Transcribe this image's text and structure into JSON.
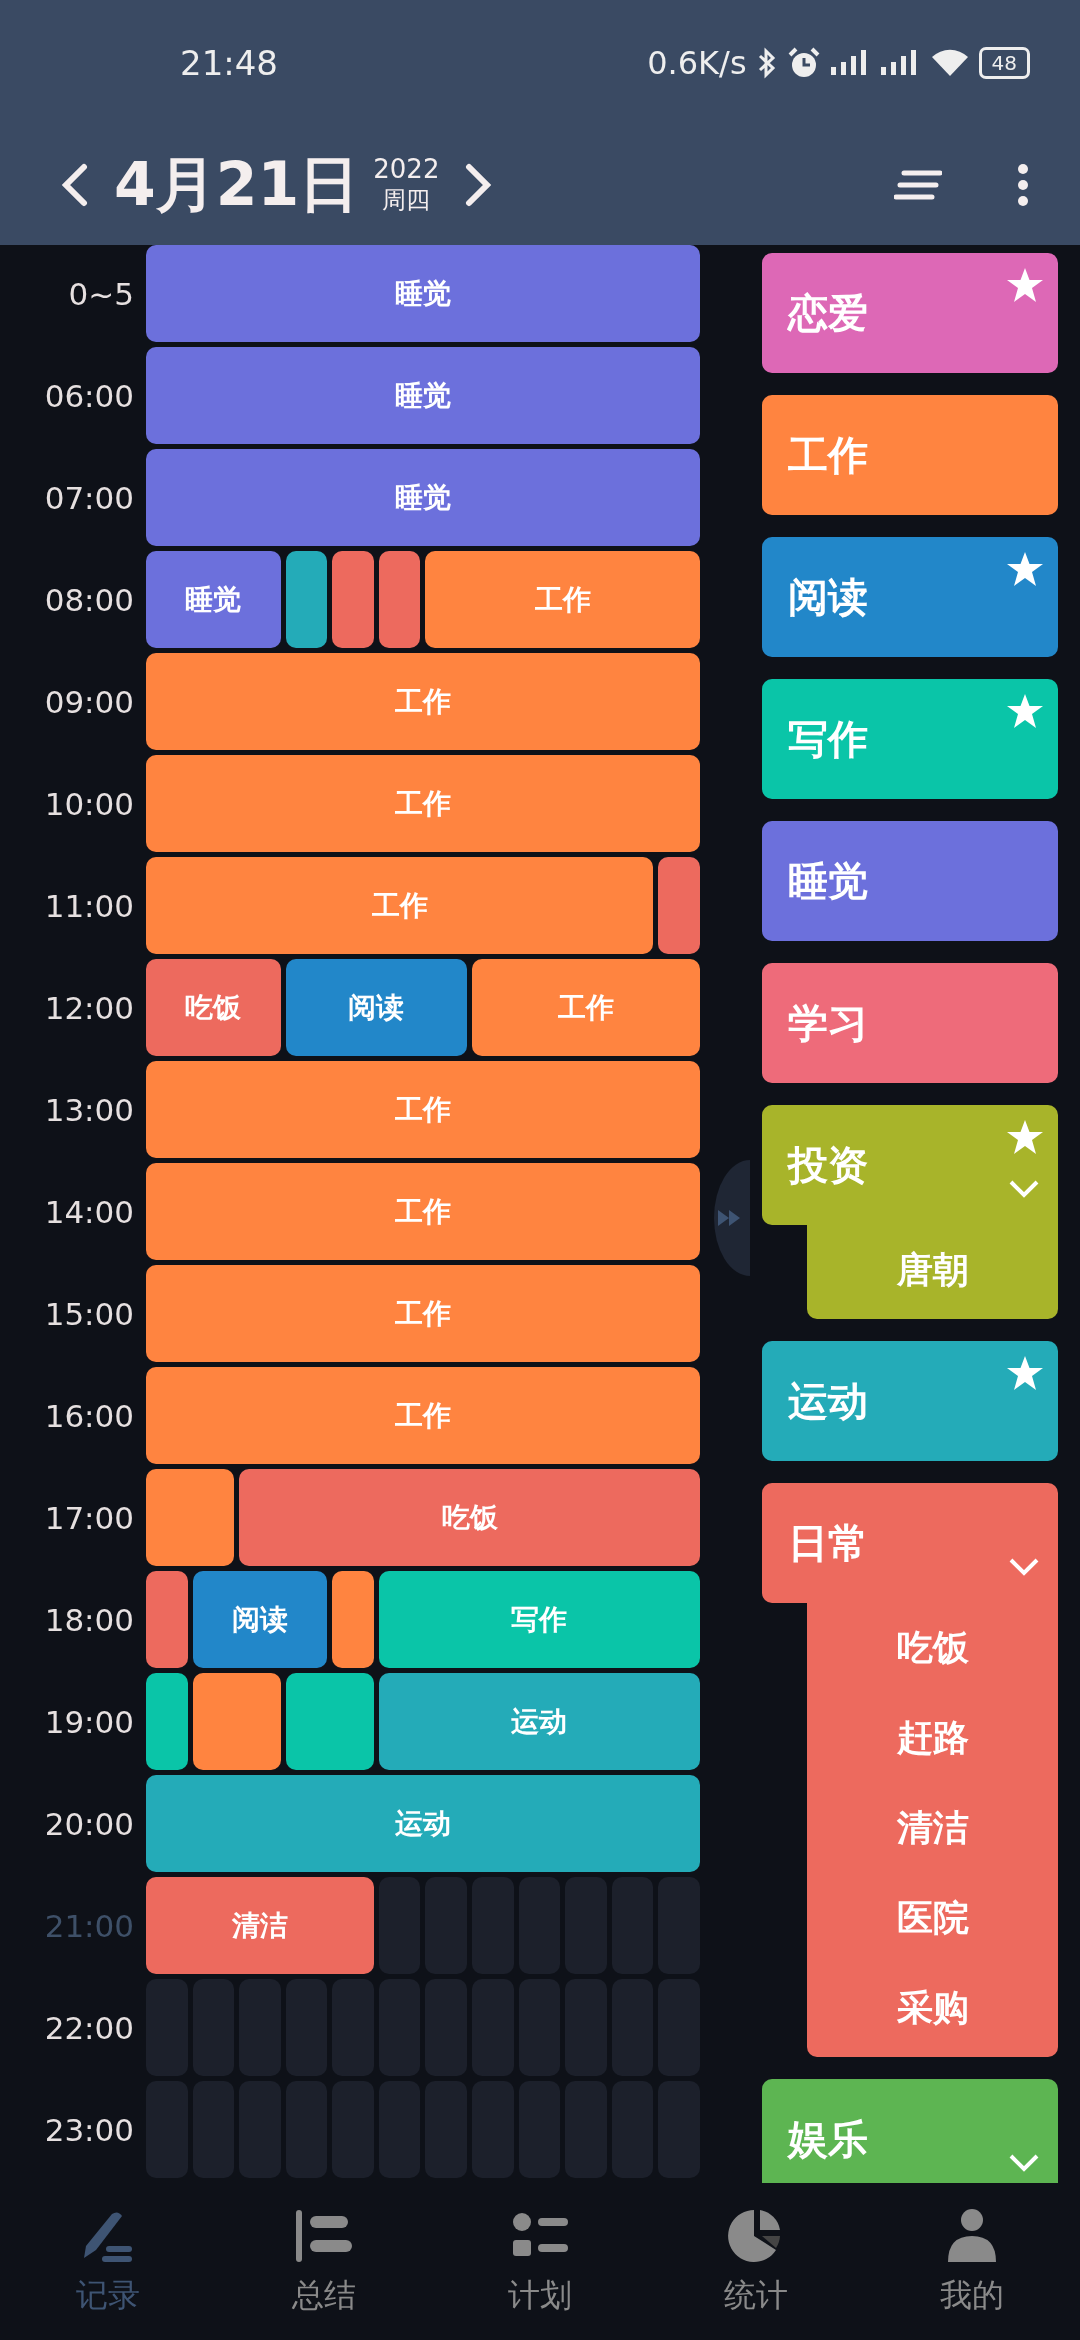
{
  "status_bar": {
    "time": "21:48",
    "speed": "0.6K/s",
    "battery": "48"
  },
  "header": {
    "date": "4月21日",
    "year": "2022",
    "weekday": "周四"
  },
  "timeline": [
    {
      "label": "0~5",
      "current": false,
      "cells": [
        {
          "kind": "activity",
          "color": "#6c70dc",
          "label": "睡觉",
          "joined": true
        },
        {
          "kind": "activity",
          "color": "#6c70dc",
          "joined": true
        },
        {
          "kind": "activity",
          "color": "#6c70dc",
          "joined": true
        },
        {
          "kind": "activity",
          "color": "#6c70dc",
          "joined": true
        },
        {
          "kind": "activity",
          "color": "#6c70dc",
          "joined": true
        },
        {
          "kind": "activity",
          "color": "#6c70dc",
          "joined": true
        },
        {
          "kind": "activity",
          "color": "#6c70dc",
          "joined": true
        },
        {
          "kind": "activity",
          "color": "#6c70dc",
          "joined": true
        },
        {
          "kind": "activity",
          "color": "#6c70dc",
          "joined": true
        },
        {
          "kind": "activity",
          "color": "#6c70dc",
          "joined": true
        },
        {
          "kind": "activity",
          "color": "#6c70dc",
          "joined": true
        },
        {
          "kind": "activity",
          "color": "#6c70dc",
          "joined": false
        }
      ]
    },
    {
      "label": "06:00",
      "current": false,
      "cells": [
        {
          "kind": "activity",
          "color": "#6c70dc",
          "label": "睡觉",
          "joined": true
        },
        {
          "kind": "activity",
          "color": "#6c70dc",
          "joined": true
        },
        {
          "kind": "activity",
          "color": "#6c70dc",
          "joined": true
        },
        {
          "kind": "activity",
          "color": "#6c70dc",
          "joined": true
        },
        {
          "kind": "activity",
          "color": "#6c70dc",
          "joined": true
        },
        {
          "kind": "activity",
          "color": "#6c70dc",
          "joined": true
        },
        {
          "kind": "activity",
          "color": "#6c70dc",
          "joined": true
        },
        {
          "kind": "activity",
          "color": "#6c70dc",
          "joined": true
        },
        {
          "kind": "activity",
          "color": "#6c70dc",
          "joined": true
        },
        {
          "kind": "activity",
          "color": "#6c70dc",
          "joined": true
        },
        {
          "kind": "activity",
          "color": "#6c70dc",
          "joined": true
        },
        {
          "kind": "activity",
          "color": "#6c70dc",
          "joined": false
        }
      ]
    },
    {
      "label": "07:00",
      "current": false,
      "cells": [
        {
          "kind": "activity",
          "color": "#6c70dc",
          "label": "睡觉",
          "joined": true
        },
        {
          "kind": "activity",
          "color": "#6c70dc",
          "joined": true
        },
        {
          "kind": "activity",
          "color": "#6c70dc",
          "joined": true
        },
        {
          "kind": "activity",
          "color": "#6c70dc",
          "joined": true
        },
        {
          "kind": "activity",
          "color": "#6c70dc",
          "joined": true
        },
        {
          "kind": "activity",
          "color": "#6c70dc",
          "joined": true
        },
        {
          "kind": "activity",
          "color": "#6c70dc",
          "joined": true
        },
        {
          "kind": "activity",
          "color": "#6c70dc",
          "joined": true
        },
        {
          "kind": "activity",
          "color": "#6c70dc",
          "joined": true
        },
        {
          "kind": "activity",
          "color": "#6c70dc",
          "joined": true
        },
        {
          "kind": "activity",
          "color": "#6c70dc",
          "joined": true
        },
        {
          "kind": "activity",
          "color": "#6c70dc",
          "joined": false
        }
      ]
    },
    {
      "label": "08:00",
      "current": false,
      "cells": [
        {
          "kind": "activity",
          "color": "#6c70dc",
          "label": "睡觉",
          "joined": true
        },
        {
          "kind": "activity",
          "color": "#6c70dc",
          "joined": true
        },
        {
          "kind": "activity",
          "color": "#6c70dc",
          "joined": false
        },
        {
          "kind": "activity",
          "color": "#24abb8",
          "joined": false
        },
        {
          "kind": "activity",
          "color": "#ed6a5e",
          "joined": false
        },
        {
          "kind": "activity",
          "color": "#ed6a5e",
          "joined": false
        },
        {
          "kind": "activity",
          "color": "#ff8440",
          "label": "工作",
          "joined": true
        },
        {
          "kind": "activity",
          "color": "#ff8440",
          "joined": true
        },
        {
          "kind": "activity",
          "color": "#ff8440",
          "joined": true
        },
        {
          "kind": "activity",
          "color": "#ff8440",
          "joined": true
        },
        {
          "kind": "activity",
          "color": "#ff8440",
          "joined": true
        },
        {
          "kind": "activity",
          "color": "#ff8440",
          "joined": false
        }
      ]
    },
    {
      "label": "09:00",
      "current": false,
      "cells": [
        {
          "kind": "activity",
          "color": "#ff8440",
          "label": "工作",
          "joined": true
        },
        {
          "kind": "activity",
          "color": "#ff8440",
          "joined": true
        },
        {
          "kind": "activity",
          "color": "#ff8440",
          "joined": true
        },
        {
          "kind": "activity",
          "color": "#ff8440",
          "joined": true
        },
        {
          "kind": "activity",
          "color": "#ff8440",
          "joined": true
        },
        {
          "kind": "activity",
          "color": "#ff8440",
          "joined": true
        },
        {
          "kind": "activity",
          "color": "#ff8440",
          "joined": true
        },
        {
          "kind": "activity",
          "color": "#ff8440",
          "joined": true
        },
        {
          "kind": "activity",
          "color": "#ff8440",
          "joined": true
        },
        {
          "kind": "activity",
          "color": "#ff8440",
          "joined": true
        },
        {
          "kind": "activity",
          "color": "#ff8440",
          "joined": true
        },
        {
          "kind": "activity",
          "color": "#ff8440",
          "joined": false
        }
      ]
    },
    {
      "label": "10:00",
      "current": false,
      "cells": [
        {
          "kind": "activity",
          "color": "#ff8440",
          "label": "工作",
          "joined": true
        },
        {
          "kind": "activity",
          "color": "#ff8440",
          "joined": true
        },
        {
          "kind": "activity",
          "color": "#ff8440",
          "joined": true
        },
        {
          "kind": "activity",
          "color": "#ff8440",
          "joined": true
        },
        {
          "kind": "activity",
          "color": "#ff8440",
          "joined": true
        },
        {
          "kind": "activity",
          "color": "#ff8440",
          "joined": true
        },
        {
          "kind": "activity",
          "color": "#ff8440",
          "joined": true
        },
        {
          "kind": "activity",
          "color": "#ff8440",
          "joined": true
        },
        {
          "kind": "activity",
          "color": "#ff8440",
          "joined": true
        },
        {
          "kind": "activity",
          "color": "#ff8440",
          "joined": true
        },
        {
          "kind": "activity",
          "color": "#ff8440",
          "joined": true
        },
        {
          "kind": "activity",
          "color": "#ff8440",
          "joined": false
        }
      ]
    },
    {
      "label": "11:00",
      "current": false,
      "cells": [
        {
          "kind": "activity",
          "color": "#ff8440",
          "label": "工作",
          "joined": true
        },
        {
          "kind": "activity",
          "color": "#ff8440",
          "joined": true
        },
        {
          "kind": "activity",
          "color": "#ff8440",
          "joined": true
        },
        {
          "kind": "activity",
          "color": "#ff8440",
          "joined": true
        },
        {
          "kind": "activity",
          "color": "#ff8440",
          "joined": true
        },
        {
          "kind": "activity",
          "color": "#ff8440",
          "joined": true
        },
        {
          "kind": "activity",
          "color": "#ff8440",
          "joined": true
        },
        {
          "kind": "activity",
          "color": "#ff8440",
          "joined": true
        },
        {
          "kind": "activity",
          "color": "#ff8440",
          "joined": true
        },
        {
          "kind": "activity",
          "color": "#ff8440",
          "joined": true
        },
        {
          "kind": "activity",
          "color": "#ff8440",
          "joined": false
        },
        {
          "kind": "activity",
          "color": "#ed6a5e",
          "joined": false
        }
      ]
    },
    {
      "label": "12:00",
      "current": false,
      "cells": [
        {
          "kind": "activity",
          "color": "#ed6a5e",
          "label": "吃饭",
          "joined": true
        },
        {
          "kind": "activity",
          "color": "#ed6a5e",
          "joined": true
        },
        {
          "kind": "activity",
          "color": "#ed6a5e",
          "joined": false
        },
        {
          "kind": "activity",
          "color": "#2287c9",
          "label": "阅读",
          "joined": true
        },
        {
          "kind": "activity",
          "color": "#2287c9",
          "joined": true
        },
        {
          "kind": "activity",
          "color": "#2287c9",
          "joined": true
        },
        {
          "kind": "activity",
          "color": "#2287c9",
          "joined": false
        },
        {
          "kind": "activity",
          "color": "#ff8440",
          "label": "工作",
          "joined": true
        },
        {
          "kind": "activity",
          "color": "#ff8440",
          "joined": true
        },
        {
          "kind": "activity",
          "color": "#ff8440",
          "joined": true
        },
        {
          "kind": "activity",
          "color": "#ff8440",
          "joined": true
        },
        {
          "kind": "activity",
          "color": "#ff8440",
          "joined": false
        }
      ]
    },
    {
      "label": "13:00",
      "current": false,
      "cells": [
        {
          "kind": "activity",
          "color": "#ff8440",
          "label": "工作",
          "joined": true
        },
        {
          "kind": "activity",
          "color": "#ff8440",
          "joined": true
        },
        {
          "kind": "activity",
          "color": "#ff8440",
          "joined": true
        },
        {
          "kind": "activity",
          "color": "#ff8440",
          "joined": true
        },
        {
          "kind": "activity",
          "color": "#ff8440",
          "joined": true
        },
        {
          "kind": "activity",
          "color": "#ff8440",
          "joined": true
        },
        {
          "kind": "activity",
          "color": "#ff8440",
          "joined": true
        },
        {
          "kind": "activity",
          "color": "#ff8440",
          "joined": true
        },
        {
          "kind": "activity",
          "color": "#ff8440",
          "joined": true
        },
        {
          "kind": "activity",
          "color": "#ff8440",
          "joined": true
        },
        {
          "kind": "activity",
          "color": "#ff8440",
          "joined": true
        },
        {
          "kind": "activity",
          "color": "#ff8440",
          "joined": false
        }
      ]
    },
    {
      "label": "14:00",
      "current": false,
      "cells": [
        {
          "kind": "activity",
          "color": "#ff8440",
          "label": "工作",
          "joined": true
        },
        {
          "kind": "activity",
          "color": "#ff8440",
          "joined": true
        },
        {
          "kind": "activity",
          "color": "#ff8440",
          "joined": true
        },
        {
          "kind": "activity",
          "color": "#ff8440",
          "joined": true
        },
        {
          "kind": "activity",
          "color": "#ff8440",
          "joined": true
        },
        {
          "kind": "activity",
          "color": "#ff8440",
          "joined": true
        },
        {
          "kind": "activity",
          "color": "#ff8440",
          "joined": true
        },
        {
          "kind": "activity",
          "color": "#ff8440",
          "joined": true
        },
        {
          "kind": "activity",
          "color": "#ff8440",
          "joined": true
        },
        {
          "kind": "activity",
          "color": "#ff8440",
          "joined": true
        },
        {
          "kind": "activity",
          "color": "#ff8440",
          "joined": true
        },
        {
          "kind": "activity",
          "color": "#ff8440",
          "joined": false
        }
      ]
    },
    {
      "label": "15:00",
      "current": false,
      "cells": [
        {
          "kind": "activity",
          "color": "#ff8440",
          "label": "工作",
          "joined": true
        },
        {
          "kind": "activity",
          "color": "#ff8440",
          "joined": true
        },
        {
          "kind": "activity",
          "color": "#ff8440",
          "joined": true
        },
        {
          "kind": "activity",
          "color": "#ff8440",
          "joined": true
        },
        {
          "kind": "activity",
          "color": "#ff8440",
          "joined": true
        },
        {
          "kind": "activity",
          "color": "#ff8440",
          "joined": true
        },
        {
          "kind": "activity",
          "color": "#ff8440",
          "joined": true
        },
        {
          "kind": "activity",
          "color": "#ff8440",
          "joined": true
        },
        {
          "kind": "activity",
          "color": "#ff8440",
          "joined": true
        },
        {
          "kind": "activity",
          "color": "#ff8440",
          "joined": true
        },
        {
          "kind": "activity",
          "color": "#ff8440",
          "joined": true
        },
        {
          "kind": "activity",
          "color": "#ff8440",
          "joined": false
        }
      ]
    },
    {
      "label": "16:00",
      "current": false,
      "cells": [
        {
          "kind": "activity",
          "color": "#ff8440",
          "label": "工作",
          "joined": true
        },
        {
          "kind": "activity",
          "color": "#ff8440",
          "joined": true
        },
        {
          "kind": "activity",
          "color": "#ff8440",
          "joined": true
        },
        {
          "kind": "activity",
          "color": "#ff8440",
          "joined": true
        },
        {
          "kind": "activity",
          "color": "#ff8440",
          "joined": true
        },
        {
          "kind": "activity",
          "color": "#ff8440",
          "joined": true
        },
        {
          "kind": "activity",
          "color": "#ff8440",
          "joined": true
        },
        {
          "kind": "activity",
          "color": "#ff8440",
          "joined": true
        },
        {
          "kind": "activity",
          "color": "#ff8440",
          "joined": true
        },
        {
          "kind": "activity",
          "color": "#ff8440",
          "joined": true
        },
        {
          "kind": "activity",
          "color": "#ff8440",
          "joined": true
        },
        {
          "kind": "activity",
          "color": "#ff8440",
          "joined": false
        }
      ]
    },
    {
      "label": "17:00",
      "current": false,
      "cells": [
        {
          "kind": "activity",
          "color": "#ff8440",
          "joined": true
        },
        {
          "kind": "activity",
          "color": "#ff8440",
          "joined": false
        },
        {
          "kind": "activity",
          "color": "#ed6a5e",
          "label": "吃饭",
          "joined": true
        },
        {
          "kind": "activity",
          "color": "#ed6a5e",
          "joined": true
        },
        {
          "kind": "activity",
          "color": "#ed6a5e",
          "joined": true
        },
        {
          "kind": "activity",
          "color": "#ed6a5e",
          "joined": true
        },
        {
          "kind": "activity",
          "color": "#ed6a5e",
          "joined": true
        },
        {
          "kind": "activity",
          "color": "#ed6a5e",
          "joined": true
        },
        {
          "kind": "activity",
          "color": "#ed6a5e",
          "joined": true
        },
        {
          "kind": "activity",
          "color": "#ed6a5e",
          "joined": true
        },
        {
          "kind": "activity",
          "color": "#ed6a5e",
          "joined": true
        },
        {
          "kind": "activity",
          "color": "#ed6a5e",
          "joined": false
        }
      ]
    },
    {
      "label": "18:00",
      "current": false,
      "cells": [
        {
          "kind": "activity",
          "color": "#ed6a5e",
          "joined": false
        },
        {
          "kind": "activity",
          "color": "#2287c9",
          "label": "阅读",
          "joined": true
        },
        {
          "kind": "activity",
          "color": "#2287c9",
          "joined": true
        },
        {
          "kind": "activity",
          "color": "#2287c9",
          "joined": false
        },
        {
          "kind": "activity",
          "color": "#ff8440",
          "joined": false
        },
        {
          "kind": "activity",
          "color": "#0ac5a8",
          "label": "写作",
          "joined": true
        },
        {
          "kind": "activity",
          "color": "#0ac5a8",
          "joined": true
        },
        {
          "kind": "activity",
          "color": "#0ac5a8",
          "joined": true
        },
        {
          "kind": "activity",
          "color": "#0ac5a8",
          "joined": true
        },
        {
          "kind": "activity",
          "color": "#0ac5a8",
          "joined": true
        },
        {
          "kind": "activity",
          "color": "#0ac5a8",
          "joined": true
        },
        {
          "kind": "activity",
          "color": "#0ac5a8",
          "joined": false
        }
      ]
    },
    {
      "label": "19:00",
      "current": false,
      "cells": [
        {
          "kind": "activity",
          "color": "#0ac5a8",
          "joined": false
        },
        {
          "kind": "activity",
          "color": "#ff8440",
          "joined": true
        },
        {
          "kind": "activity",
          "color": "#ff8440",
          "joined": false
        },
        {
          "kind": "activity",
          "color": "#0ac5a8",
          "joined": true
        },
        {
          "kind": "activity",
          "color": "#0ac5a8",
          "joined": false
        },
        {
          "kind": "activity",
          "color": "#24abb8",
          "label": "运动",
          "joined": true
        },
        {
          "kind": "activity",
          "color": "#24abb8",
          "joined": true
        },
        {
          "kind": "activity",
          "color": "#24abb8",
          "joined": true
        },
        {
          "kind": "activity",
          "color": "#24abb8",
          "joined": true
        },
        {
          "kind": "activity",
          "color": "#24abb8",
          "joined": true
        },
        {
          "kind": "activity",
          "color": "#24abb8",
          "joined": true
        },
        {
          "kind": "activity",
          "color": "#24abb8",
          "joined": false
        }
      ]
    },
    {
      "label": "20:00",
      "current": false,
      "cells": [
        {
          "kind": "activity",
          "color": "#24abb8",
          "label": "运动",
          "joined": true
        },
        {
          "kind": "activity",
          "color": "#24abb8",
          "joined": true
        },
        {
          "kind": "activity",
          "color": "#24abb8",
          "joined": true
        },
        {
          "kind": "activity",
          "color": "#24abb8",
          "joined": true
        },
        {
          "kind": "activity",
          "color": "#24abb8",
          "joined": true
        },
        {
          "kind": "activity",
          "color": "#24abb8",
          "joined": true
        },
        {
          "kind": "activity",
          "color": "#24abb8",
          "joined": true
        },
        {
          "kind": "activity",
          "color": "#24abb8",
          "joined": true
        },
        {
          "kind": "activity",
          "color": "#24abb8",
          "joined": true
        },
        {
          "kind": "activity",
          "color": "#24abb8",
          "joined": true
        },
        {
          "kind": "activity",
          "color": "#24abb8",
          "joined": true
        },
        {
          "kind": "activity",
          "color": "#24abb8",
          "joined": false
        }
      ]
    },
    {
      "label": "21:00",
      "current": true,
      "cells": [
        {
          "kind": "activity",
          "color": "#ed6a5e",
          "label": "清洁",
          "joined": true
        },
        {
          "kind": "activity",
          "color": "#ed6a5e",
          "joined": true
        },
        {
          "kind": "activity",
          "color": "#ed6a5e",
          "joined": true
        },
        {
          "kind": "activity",
          "color": "#ed6a5e",
          "joined": true
        },
        {
          "kind": "activity",
          "color": "#ed6a5e",
          "joined": false
        },
        {
          "kind": "empty"
        },
        {
          "kind": "empty"
        },
        {
          "kind": "empty"
        },
        {
          "kind": "empty"
        },
        {
          "kind": "empty"
        },
        {
          "kind": "empty"
        },
        {
          "kind": "empty"
        }
      ]
    },
    {
      "label": "22:00",
      "current": false,
      "cells": [
        {
          "kind": "empty"
        },
        {
          "kind": "empty"
        },
        {
          "kind": "empty"
        },
        {
          "kind": "empty"
        },
        {
          "kind": "empty"
        },
        {
          "kind": "empty"
        },
        {
          "kind": "empty"
        },
        {
          "kind": "empty"
        },
        {
          "kind": "empty"
        },
        {
          "kind": "empty"
        },
        {
          "kind": "empty"
        },
        {
          "kind": "empty"
        }
      ]
    },
    {
      "label": "23:00",
      "current": false,
      "cells": [
        {
          "kind": "empty"
        },
        {
          "kind": "empty"
        },
        {
          "kind": "empty"
        },
        {
          "kind": "empty"
        },
        {
          "kind": "empty"
        },
        {
          "kind": "empty"
        },
        {
          "kind": "empty"
        },
        {
          "kind": "empty"
        },
        {
          "kind": "empty"
        },
        {
          "kind": "empty"
        },
        {
          "kind": "empty"
        },
        {
          "kind": "empty"
        }
      ]
    }
  ],
  "categories": [
    {
      "label": "恋爱",
      "color": "#dd68b6",
      "starred": true,
      "collapsible": false
    },
    {
      "label": "工作",
      "color": "#ff8440",
      "starred": false,
      "collapsible": false
    },
    {
      "label": "阅读",
      "color": "#2287c9",
      "starred": true,
      "collapsible": false
    },
    {
      "label": "写作",
      "color": "#0ac5a8",
      "starred": true,
      "collapsible": false
    },
    {
      "label": "睡觉",
      "color": "#6c70dc",
      "starred": false,
      "collapsible": false
    },
    {
      "label": "学习",
      "color": "#ee6b7a",
      "starred": false,
      "collapsible": false
    },
    {
      "label": "投资",
      "color": "#a8b42a",
      "starred": true,
      "collapsible": true,
      "children": [
        "唐朝"
      ]
    },
    {
      "label": "运动",
      "color": "#24abb8",
      "starred": true,
      "collapsible": false
    },
    {
      "label": "日常",
      "color": "#ed6a5e",
      "starred": false,
      "collapsible": true,
      "children": [
        "吃饭",
        "赶路",
        "清洁",
        "医院",
        "采购"
      ]
    },
    {
      "label": "娱乐",
      "color": "#5db552",
      "starred": false,
      "collapsible": true
    }
  ],
  "bottom_nav": [
    {
      "label": "记录",
      "selected": true
    },
    {
      "label": "总结",
      "selected": false
    },
    {
      "label": "计划",
      "selected": false
    },
    {
      "label": "统计",
      "selected": false
    },
    {
      "label": "我的",
      "selected": false
    }
  ]
}
